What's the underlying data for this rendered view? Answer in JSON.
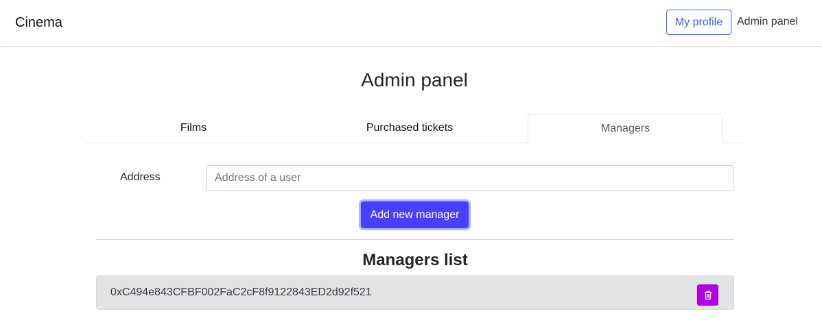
{
  "navbar": {
    "brand": "Cinema",
    "my_profile_label": "My profile",
    "admin_panel_label": "Admin panel"
  },
  "page": {
    "title": "Admin panel"
  },
  "tabs": [
    {
      "label": "Films",
      "active": false
    },
    {
      "label": "Purchased tickets",
      "active": false
    },
    {
      "label": "Managers",
      "active": true
    }
  ],
  "form": {
    "address_label": "Address",
    "address_value": "",
    "address_placeholder": "Address of a user",
    "add_button_label": "Add new manager"
  },
  "managers_list": {
    "title": "Managers list",
    "items": [
      {
        "address": "0xC494e843CFBF002FaC2cF8f9122843ED2d92f521",
        "delete_icon": "trash-icon"
      }
    ]
  },
  "colors": {
    "primary": "#3d5ee8",
    "add_button": "#4840ff",
    "delete_button": "#b100e8",
    "list_item_bg": "#e2e3e5"
  }
}
